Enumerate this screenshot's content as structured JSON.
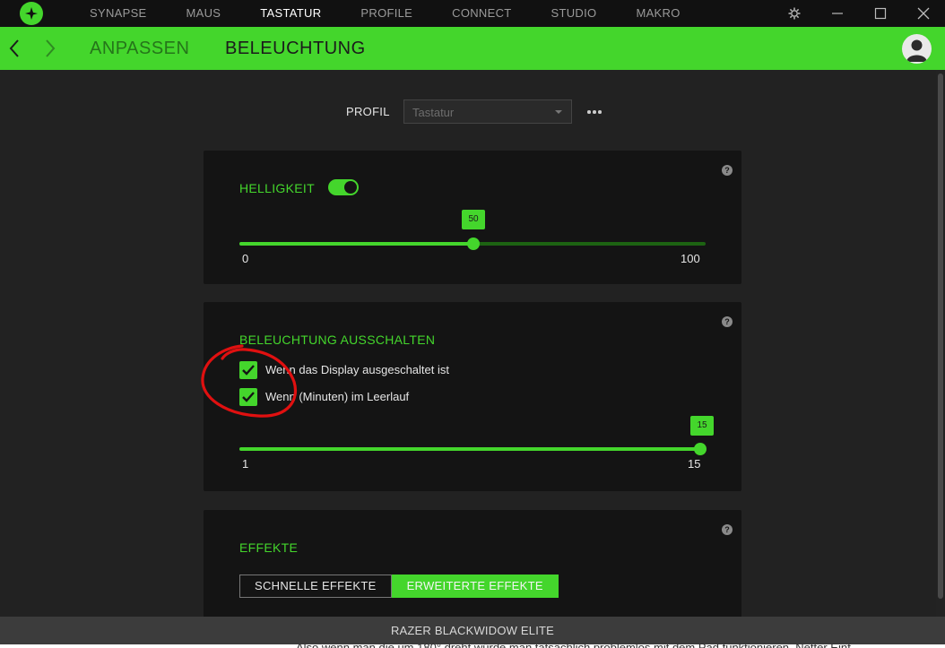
{
  "window": {
    "nav_tabs": [
      {
        "label": "SYNAPSE"
      },
      {
        "label": "MAUS"
      },
      {
        "label": "TASTATUR"
      },
      {
        "label": "PROFILE"
      },
      {
        "label": "CONNECT"
      },
      {
        "label": "STUDIO"
      },
      {
        "label": "MAKRO"
      }
    ],
    "active_tab": "TASTATUR"
  },
  "subnav": {
    "items": [
      {
        "label": "ANPASSEN"
      },
      {
        "label": "BELEUCHTUNG"
      }
    ],
    "active": "BELEUCHTUNG"
  },
  "profile": {
    "label": "PROFIL",
    "selected": "Tastatur"
  },
  "brightness": {
    "title": "HELLIGKEIT",
    "enabled": true,
    "value": "50",
    "min": "0",
    "max": "100",
    "help": "?"
  },
  "lighting_off": {
    "title": "BELEUCHTUNG AUSSCHALTEN",
    "help": "?",
    "options": [
      {
        "label": "Wenn das Display ausgeschaltet ist",
        "checked": true
      },
      {
        "label": "Wenn (Minuten) im Leerlauf",
        "checked": true
      }
    ],
    "idle_minutes": "15",
    "min": "1",
    "max": "15"
  },
  "effects": {
    "title": "EFFEKTE",
    "help": "?",
    "buttons": [
      {
        "label": "SCHNELLE EFFEKTE",
        "selected": false
      },
      {
        "label": "ERWEITERTE EFFEKTE",
        "selected": true
      }
    ]
  },
  "footer": {
    "device": "RAZER BLACKWIDOW ELITE"
  },
  "below_text": "Also wenn man die um 180° dreht würde man tatsächlich problemlos mit dem Pad funktionieren. Netter Einf",
  "colors": {
    "accent": "#44d62c",
    "annotation": "#e01010",
    "background": "#222222",
    "card": "#141414"
  }
}
